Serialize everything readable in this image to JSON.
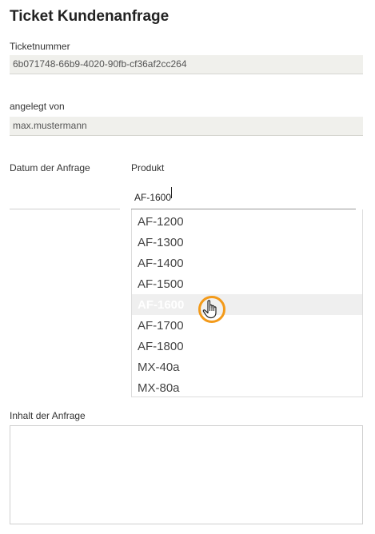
{
  "page": {
    "title": "Ticket Kundenanfrage"
  },
  "ticket": {
    "number_label": "Ticketnummer",
    "number_value": "6b071748-66b9-4020-90fb-cf36af2cc264",
    "created_by_label": "angelegt von",
    "created_by_value": "max.mustermann"
  },
  "date": {
    "label": "Datum der Anfrage",
    "value": ""
  },
  "product": {
    "label": "Produkt",
    "value": "AF-1600",
    "options": [
      "AF-1200",
      "AF-1300",
      "AF-1400",
      "AF-1500",
      "AF-1600",
      "AF-1700",
      "AF-1800",
      "MX-40a",
      "MX-80a"
    ],
    "hovered": "AF-1600"
  },
  "content": {
    "label": "Inhalt der Anfrage",
    "value": ""
  },
  "icons": {
    "cursor": "hand-pointer-icon"
  },
  "colors": {
    "cursor_ring": "#f39a1a",
    "readonly_bg": "#f0f0ec",
    "hover_bg": "#efefef"
  }
}
